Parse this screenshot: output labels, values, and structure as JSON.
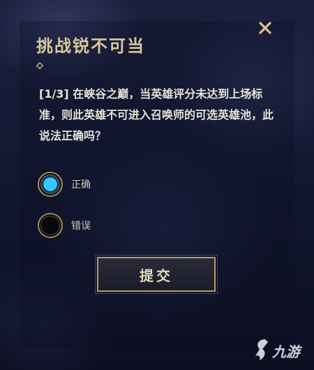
{
  "dialog": {
    "title": "挑战锐不可当",
    "close_icon": "close-icon",
    "question": "[1/3] 在峡谷之巅，当英雄评分未达到上场标准，则此英雄不可进入召唤师的可选英雄池，此说法正确吗？",
    "options": [
      {
        "label": "正确",
        "selected": true
      },
      {
        "label": "错误",
        "selected": false
      }
    ],
    "submit_label": "提交"
  },
  "watermark": {
    "text": "九游"
  },
  "colors": {
    "gold": "#d9c89a",
    "radio_selected": "#3cc3ff",
    "button_border": "#b79d5e"
  }
}
